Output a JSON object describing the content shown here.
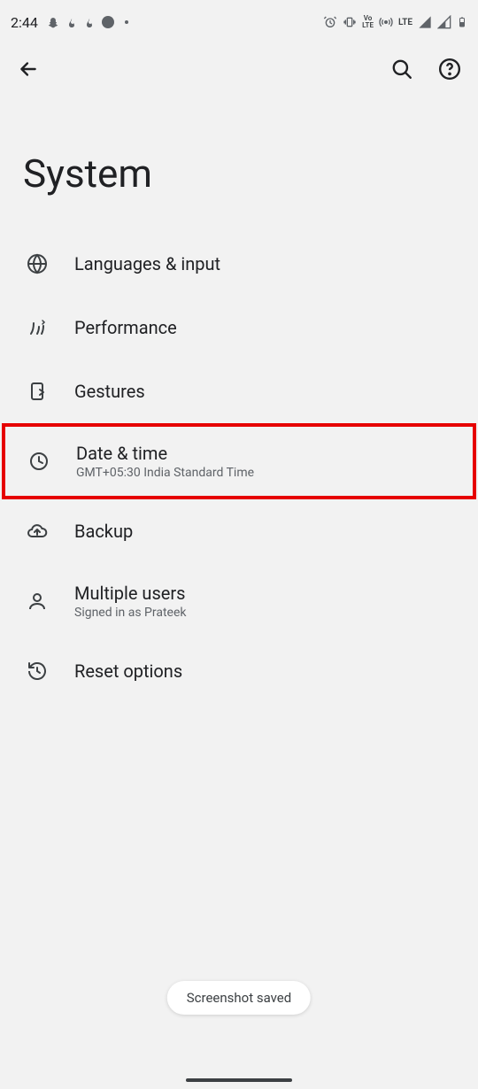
{
  "statusbar": {
    "time": "2:44",
    "vpn_label": "VoLTE",
    "lte_label": "LTE"
  },
  "appbar": {},
  "page": {
    "title": "System"
  },
  "items": [
    {
      "title": "Languages & input",
      "sub": ""
    },
    {
      "title": "Performance",
      "sub": ""
    },
    {
      "title": "Gestures",
      "sub": ""
    },
    {
      "title": "Date & time",
      "sub": "GMT+05:30 India Standard Time"
    },
    {
      "title": "Backup",
      "sub": ""
    },
    {
      "title": "Multiple users",
      "sub": "Signed in as Prateek"
    },
    {
      "title": "Reset options",
      "sub": ""
    }
  ],
  "toast": {
    "text": "Screenshot saved"
  }
}
